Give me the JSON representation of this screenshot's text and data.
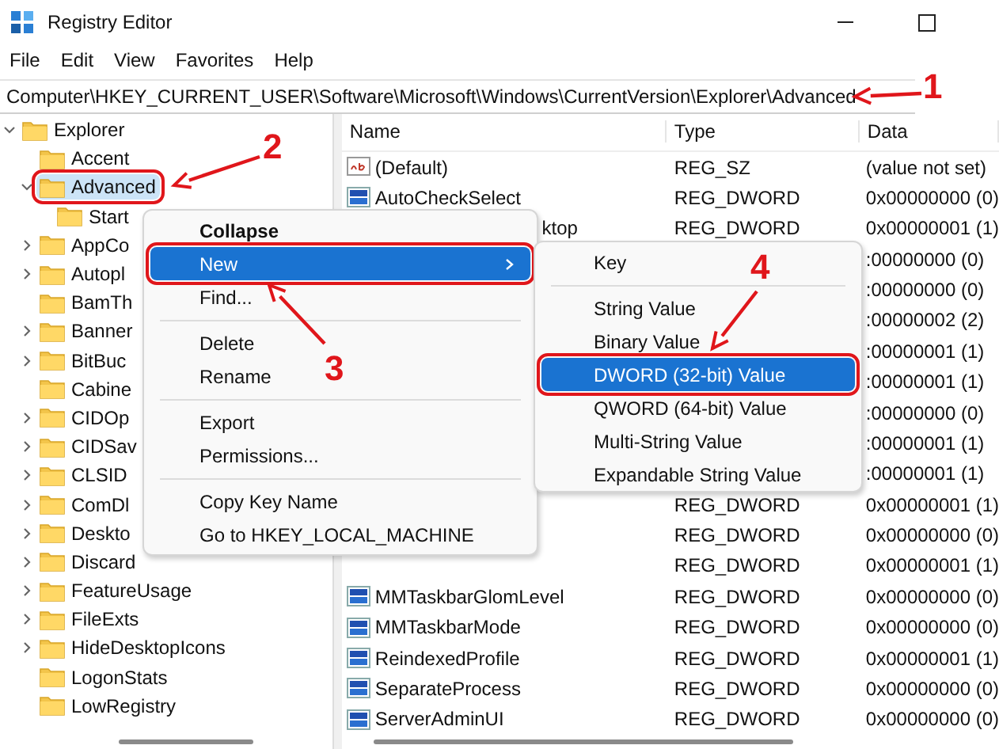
{
  "window": {
    "title": "Registry Editor"
  },
  "menu_bar": [
    "File",
    "Edit",
    "View",
    "Favorites",
    "Help"
  ],
  "address_bar": {
    "value": "Computer\\HKEY_CURRENT_USER\\Software\\Microsoft\\Windows\\CurrentVersion\\Explorer\\Advanced"
  },
  "tree": [
    {
      "label": "Explorer",
      "expanded": true,
      "selected": false,
      "framed": false,
      "children": [
        {
          "label": "Accent",
          "selected": false,
          "framed": false
        },
        {
          "label": "Advanced",
          "expanded": true,
          "selected": true,
          "framed": true,
          "children": [
            {
              "label": "Start",
              "selected": false,
              "framed": false
            }
          ]
        },
        {
          "label": "AppCo",
          "expanded": false,
          "selected": false,
          "framed": false
        },
        {
          "label": "Autopl",
          "expanded": false,
          "selected": false,
          "framed": false
        },
        {
          "label": "BamTh",
          "selected": false,
          "framed": false
        },
        {
          "label": "Banner",
          "expanded": false,
          "selected": false,
          "framed": false
        },
        {
          "label": "BitBuc",
          "expanded": false,
          "selected": false,
          "framed": false
        },
        {
          "label": "Cabine",
          "selected": false,
          "framed": false
        },
        {
          "label": "CIDOp",
          "expanded": false,
          "selected": false,
          "framed": false
        },
        {
          "label": "CIDSav",
          "expanded": false,
          "selected": false,
          "framed": false
        },
        {
          "label": "CLSID",
          "expanded": false,
          "selected": false,
          "framed": false
        },
        {
          "label": "ComDl",
          "expanded": false,
          "selected": false,
          "framed": false
        },
        {
          "label": "Deskto",
          "expanded": false,
          "selected": false,
          "framed": false
        },
        {
          "label": "Discard",
          "expanded": false,
          "selected": false,
          "framed": false
        },
        {
          "label": "FeatureUsage",
          "expanded": false,
          "selected": false,
          "framed": false
        },
        {
          "label": "FileExts",
          "expanded": false,
          "selected": false,
          "framed": false
        },
        {
          "label": "HideDesktopIcons",
          "expanded": false,
          "selected": false,
          "framed": false
        },
        {
          "label": "LogonStats",
          "selected": false,
          "framed": false
        },
        {
          "label": "LowRegistry",
          "selected": false,
          "framed": false
        }
      ]
    }
  ],
  "values": {
    "columns": [
      "Name",
      "Type",
      "Data"
    ],
    "rows": [
      {
        "kind": "string",
        "name": "(Default)",
        "type": "REG_SZ",
        "data": "(value not set)"
      },
      {
        "kind": "dword",
        "name": "AutoCheckSelect",
        "type": "REG_DWORD",
        "data": "0x00000000 (0)"
      },
      {
        "name": "ktop",
        "partly_hidden": true,
        "type": "REG_DWORD",
        "data": "0x00000001 (1)"
      },
      {
        "data": ":00000000 (0)"
      },
      {
        "data": ":00000000 (0)"
      },
      {
        "data": ":00000002 (2)"
      },
      {
        "data": ":00000001 (1)"
      },
      {
        "data": ":00000001 (1)"
      },
      {
        "data": ":00000000 (0)"
      },
      {
        "data": ":00000001 (1)"
      },
      {
        "data": ":00000001 (1)"
      },
      {
        "type": "REG_DWORD",
        "data": "0x00000001 (1)"
      },
      {
        "type": "REG_DWORD",
        "data": "0x00000000 (0)"
      },
      {
        "type": "REG_DWORD",
        "data": "0x00000001 (1)"
      },
      {
        "kind": "dword",
        "name": "MMTaskbarGlomLevel",
        "type": "REG_DWORD",
        "data": "0x00000000 (0)"
      },
      {
        "kind": "dword",
        "name": "MMTaskbarMode",
        "type": "REG_DWORD",
        "data": "0x00000000 (0)"
      },
      {
        "kind": "dword",
        "name": "ReindexedProfile",
        "type": "REG_DWORD",
        "data": "0x00000001 (1)"
      },
      {
        "kind": "dword",
        "name": "SeparateProcess",
        "type": "REG_DWORD",
        "data": "0x00000000 (0)"
      },
      {
        "kind": "dword",
        "name": "ServerAdminUI",
        "type": "REG_DWORD",
        "data": "0x00000000 (0)"
      }
    ]
  },
  "context_menu": {
    "groups": [
      [
        {
          "label": "Collapse",
          "bold": true,
          "selected": false,
          "framed": false
        },
        {
          "label": "New",
          "submenu": true,
          "selected": true,
          "framed": true
        },
        {
          "label": "Find...",
          "selected": false,
          "framed": false
        }
      ],
      [
        {
          "label": "Delete",
          "selected": false,
          "framed": false
        },
        {
          "label": "Rename",
          "selected": false,
          "framed": false
        }
      ],
      [
        {
          "label": "Export",
          "selected": false,
          "framed": false
        },
        {
          "label": "Permissions...",
          "selected": false,
          "framed": false
        }
      ],
      [
        {
          "label": "Copy Key Name",
          "selected": false,
          "framed": false
        },
        {
          "label": "Go to HKEY_LOCAL_MACHINE",
          "selected": false,
          "framed": false
        }
      ]
    ]
  },
  "submenu": {
    "groups": [
      [
        {
          "label": "Key",
          "selected": false,
          "framed": false
        }
      ],
      [
        {
          "label": "String Value",
          "selected": false,
          "framed": false
        },
        {
          "label": "Binary Value",
          "selected": false,
          "framed": false
        },
        {
          "label": "DWORD (32-bit) Value",
          "selected": true,
          "framed": true
        },
        {
          "label": "QWORD (64-bit) Value",
          "selected": false,
          "framed": false
        },
        {
          "label": "Multi-String Value",
          "selected": false,
          "framed": false
        },
        {
          "label": "Expandable String Value",
          "selected": false,
          "framed": false
        }
      ]
    ]
  },
  "annotations": [
    {
      "label": "1"
    },
    {
      "label": "2"
    },
    {
      "label": "3"
    },
    {
      "label": "4"
    }
  ]
}
